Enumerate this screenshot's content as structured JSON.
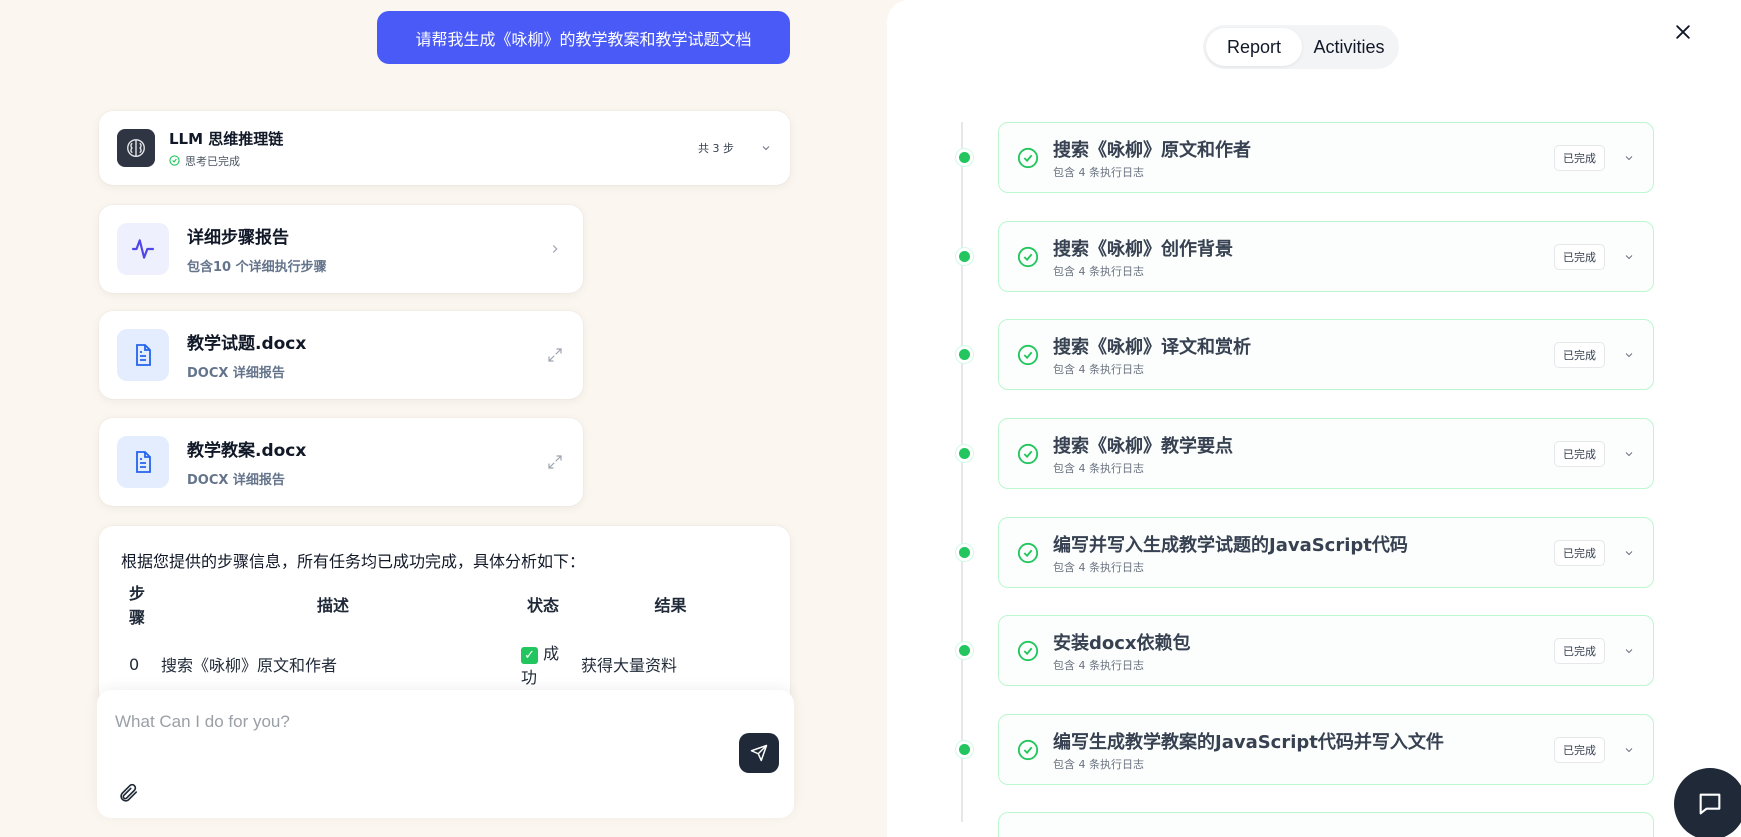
{
  "user_message": "请帮我生成《咏柳》的教学教案和教学试题文档",
  "llm_chain": {
    "title": "LLM 思维推理链",
    "status": "思考已完成",
    "steps": "共 3 步"
  },
  "detail_report": {
    "title": "详细步骤报告",
    "subtitle": "包含10 个详细执行步骤"
  },
  "files": [
    {
      "name": "教学试题.docx",
      "type": "DOCX 详细报告"
    },
    {
      "name": "教学教案.docx",
      "type": "DOCX 详细报告"
    }
  ],
  "summary": {
    "intro": "根据您提供的步骤信息，所有任务均已成功完成，具体分析如下：",
    "headers": [
      "步骤",
      "描述",
      "状态",
      "结果"
    ],
    "rows": [
      {
        "step": "0",
        "desc": "搜索《咏柳》原文和作者",
        "status": "成功",
        "result": "获得大量资料"
      }
    ]
  },
  "input": {
    "placeholder": "What Can I do for you?",
    "value": ""
  },
  "panel": {
    "tabs": [
      "Report",
      "Activities"
    ],
    "active_tab": "Report",
    "steps": [
      {
        "title": "搜索《咏柳》原文和作者",
        "sub": "包含 4 条执行日志",
        "badge": "已完成"
      },
      {
        "title": "搜索《咏柳》创作背景",
        "sub": "包含 4 条执行日志",
        "badge": "已完成"
      },
      {
        "title": "搜索《咏柳》译文和赏析",
        "sub": "包含 4 条执行日志",
        "badge": "已完成"
      },
      {
        "title": "搜索《咏柳》教学要点",
        "sub": "包含 4 条执行日志",
        "badge": "已完成"
      },
      {
        "title": "编写并写入生成教学试题的JavaScript代码",
        "sub": "包含 4 条执行日志",
        "badge": "已完成"
      },
      {
        "title": "安装docx依赖包",
        "sub": "包含 4 条执行日志",
        "badge": "已完成"
      },
      {
        "title": "编写生成教学教案的JavaScript代码并写入文件",
        "sub": "包含 4 条执行日志",
        "badge": "已完成"
      }
    ]
  },
  "colors": {
    "accent": "#4a5af7",
    "success": "#22c55e",
    "dark": "#1f2937",
    "background": "#fbf7f0"
  },
  "icons": {
    "llm": "brain-icon",
    "report": "activity-icon",
    "file": "document-icon",
    "expand": "expand-icon",
    "send": "send-icon",
    "attach": "paperclip-icon",
    "close": "close-icon",
    "check": "check-circle-icon",
    "chevron": "chevron-down-icon",
    "chat": "chat-icon"
  }
}
